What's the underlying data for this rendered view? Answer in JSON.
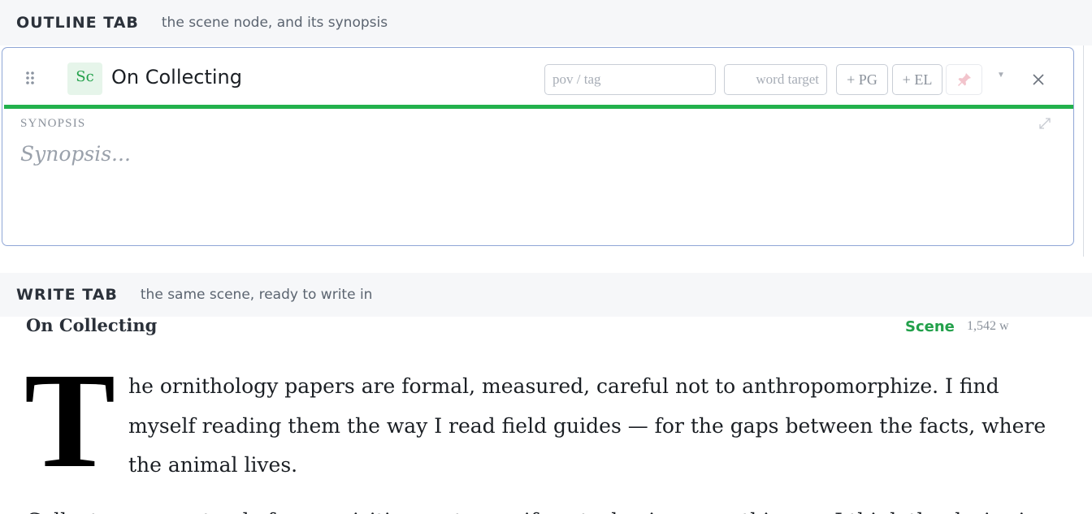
{
  "outline_section": {
    "title": "OUTLINE TAB",
    "subtitle": "the scene node, and its synopsis"
  },
  "node": {
    "type_badge": "Sc",
    "title": "On Collecting",
    "pov_placeholder": "pov / tag",
    "word_target_placeholder": "word target",
    "pg_button": "+ PG",
    "el_button": "+ EL",
    "synopsis_label": "SYNOPSIS",
    "synopsis_placeholder": "Synopsis...",
    "status_color": "#22b14c"
  },
  "write_section": {
    "title": "WRITE TAB",
    "subtitle": "the same scene, ready to write in"
  },
  "scene": {
    "title": "On Collecting",
    "type": "Scene",
    "word_count": "1,542 w",
    "dropcap": "T",
    "paragraph1": "he ornithology papers are formal, measured, careful not to anthropomorphize. I find myself reading them the way I read field guides — for the gaps between the facts, where the animal lives.",
    "paragraph2": "Collectors are not only for acquisition, not even if we truly give everything up I think the desire is"
  },
  "icons": {
    "drag": "drag-handle-icon",
    "pin": "pin-icon",
    "dropdown": "chevron-down-icon",
    "close": "close-icon",
    "expand": "expand-icon"
  },
  "colors": {
    "accent_green": "#22a04a",
    "card_border": "#8fa6d6"
  }
}
